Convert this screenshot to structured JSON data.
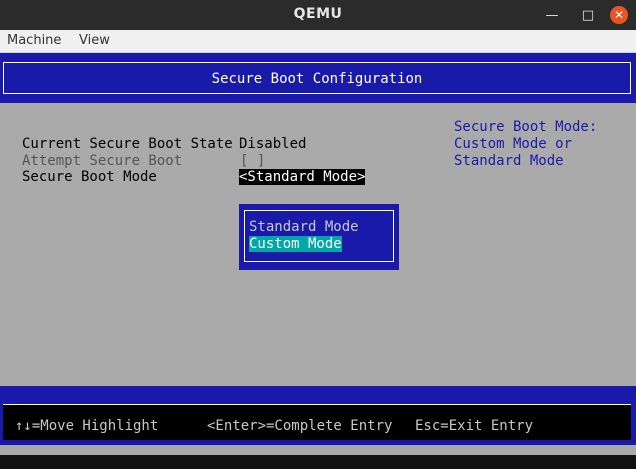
{
  "window": {
    "title": "QEMU",
    "minimize_glyph": "—",
    "maximize_glyph": "□",
    "close_glyph": "✕"
  },
  "menu": {
    "items": [
      "Machine",
      "View"
    ]
  },
  "header": {
    "title": "Secure Boot Configuration"
  },
  "settings": [
    {
      "label": "Current Secure Boot State",
      "value": "Disabled"
    },
    {
      "label": "Attempt Secure Boot",
      "value": "[ ]"
    },
    {
      "label": "Secure Boot Mode",
      "value": "<Standard Mode>"
    }
  ],
  "help_text": [
    "Secure Boot Mode:",
    "Custom Mode or",
    "Standard Mode"
  ],
  "popup": {
    "options": [
      "Standard Mode",
      "Custom Mode"
    ],
    "selected": "Custom Mode"
  },
  "footer": {
    "keys": [
      "↑↓=Move Highlight",
      "<Enter>=Complete Entry",
      "Esc=Exit Entry"
    ]
  },
  "colors": {
    "bios_blue": "#1a1aaa",
    "bios_gray": "#aaaaaa",
    "highlight_cyan": "#00a8a8",
    "close_orange": "#e95420"
  },
  "icons": {
    "minimize": "minimize-icon",
    "maximize": "maximize-icon",
    "close": "close-icon"
  }
}
